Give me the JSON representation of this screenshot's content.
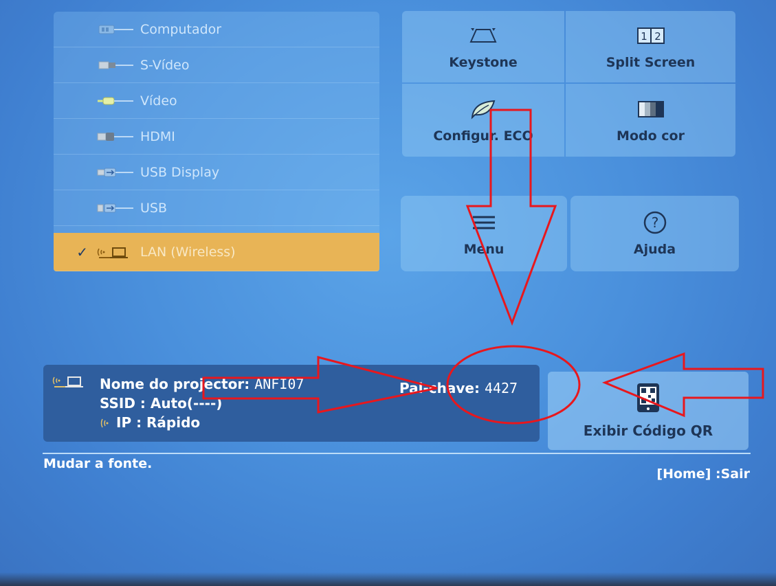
{
  "sources": [
    {
      "label": "Computador",
      "icon": "vga-connector-icon",
      "selected": false
    },
    {
      "label": "S-Vídeo",
      "icon": "svideo-connector-icon",
      "selected": false
    },
    {
      "label": "Vídeo",
      "icon": "rca-connector-icon",
      "selected": false
    },
    {
      "label": "HDMI",
      "icon": "hdmi-connector-icon",
      "selected": false
    },
    {
      "label": "USB Display",
      "icon": "usb-display-icon",
      "selected": false
    },
    {
      "label": "USB",
      "icon": "usb-icon",
      "selected": false
    },
    {
      "label": "LAN (Wireless)",
      "icon": "wireless-lan-icon",
      "selected": true,
      "check": "✓"
    }
  ],
  "tiles": {
    "keystone": "Keystone",
    "split_screen": "Split Screen",
    "split_glyph_1": "1",
    "split_glyph_2": "2",
    "eco": "Configur. ECO",
    "color_mode": "Modo cor",
    "menu": "Menu",
    "help": "Ajuda",
    "help_glyph": "?"
  },
  "info": {
    "projector_name_label": "Nome do projector:",
    "projector_name_value": "ANFI07",
    "passkey_label": "Pal-chave:",
    "passkey_value": "4427",
    "ssid_label": "SSID :",
    "ssid_value": "Auto(----)",
    "ip_label": "IP :",
    "ip_value": "Rápido"
  },
  "qr_button": "Exibir Código QR",
  "status_text": "Mudar a fonte.",
  "exit_hint": "[Home] :Sair",
  "colors": {
    "background": "#4a90dc",
    "selected": "#e8b456",
    "info_panel": "#2f5e9e",
    "annotation": "#e8171d"
  }
}
